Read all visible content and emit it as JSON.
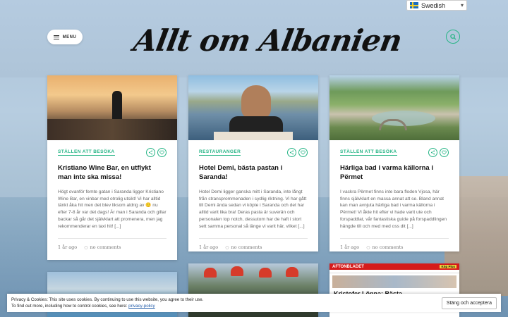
{
  "site": {
    "logo_text": "Allt om Albanien",
    "menu_label": "MENU"
  },
  "language": {
    "selected": "Swedish"
  },
  "cards": [
    {
      "category": "STÄLLEN ATT BESÖKA",
      "title": "Kristiano Wine Bar, en utflykt man inte ska missa!",
      "excerpt": "Högt ovanför femte gatan i Saranda ligger Kristiano Wine Bar, en vinbar med otrolig utsikt! Vi har alltid tänkt åka hit men det blev liksom aldrig av 🙂 nu efter 7-8 år var det dags! Är man i Saranda och gillar backar så går det självklart att promenera, men jag rekommenderar en taxi hit! [...]",
      "date": "1 år ago",
      "comments": "no comments"
    },
    {
      "category": "RESTAURANGER",
      "title": "Hotel Demi, bästa pastan i Saranda!",
      "excerpt": "Hotel Demi ligger ganska mitt i Saranda, inte långt från stransprommenaden i sydlig riktning. Vi har gått till Demi ända sedan vi köpte i Saranda och det har alltid varit lika bra! Deras pasta är suverän och personalen top notch, dessutom har de haft i stort sett samma personal så länge vi varit här, vilket [...]",
      "date": "1 år ago",
      "comments": "no comments"
    },
    {
      "category": "STÄLLEN ATT BESÖKA",
      "title": "Härliga bad i varma källorna i Përmet",
      "excerpt": "I vackra Përmet finns inte bara floden Vjosa, här finns självklart en massa annat att se. Bland annat kan man avnjuta härliga bad i varma källorna i Përmet! Vi åkte hit efter vi hade varit ute och forspaddlat, vår fantastiska guide på forspaddlingen hängde till och med med oss dit [...]",
      "date": "1 år ago",
      "comments": "no comments"
    }
  ],
  "bottom_cards": [
    {
      "headline": ""
    },
    {
      "headline": ""
    },
    {
      "headline": "Kristofer Lönna: Bästa",
      "masthead": "AFTONBLADET",
      "badge": "Köp Plus"
    }
  ],
  "cookie": {
    "line1": "Privacy & Cookies: This site uses cookies. By continuing to use this website, you agree to their use.",
    "line2": "To find out more, including how to control cookies, see here:",
    "link": "privacy-policy",
    "accept": "Stäng och acceptera"
  },
  "colors": {
    "accent": "#27b586"
  }
}
